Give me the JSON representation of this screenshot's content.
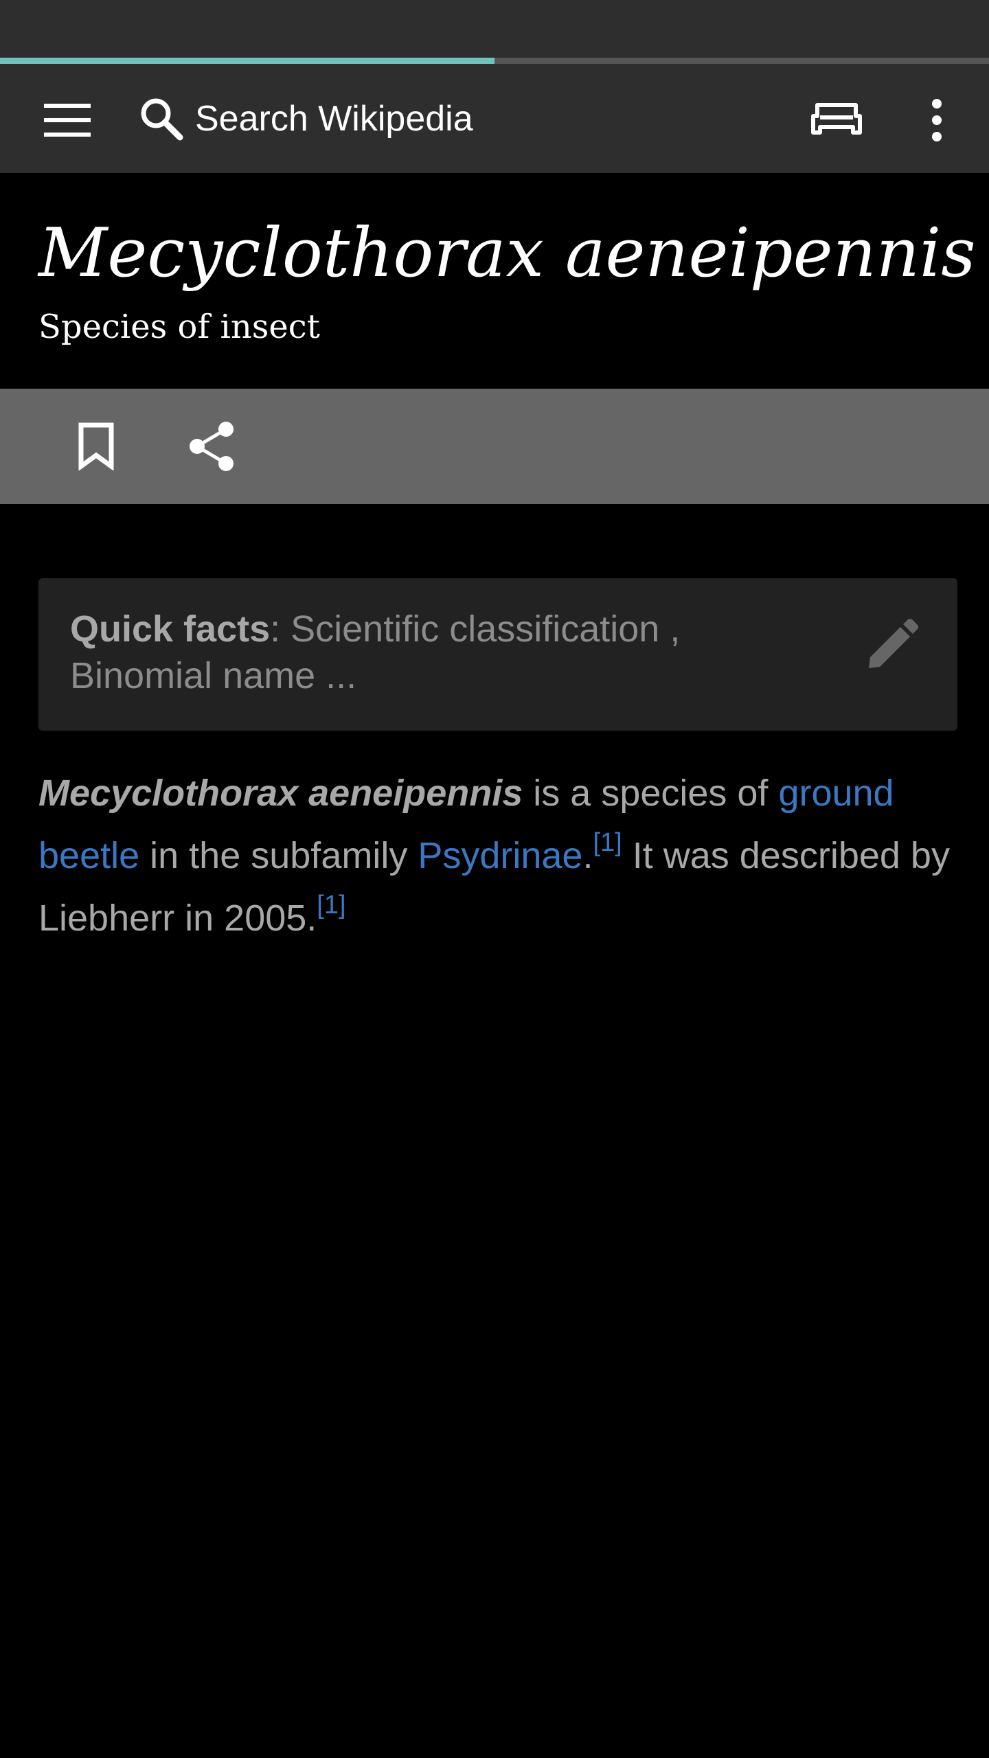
{
  "progress": {
    "fraction": 0.5
  },
  "toolbar": {
    "menu_icon": "hamburger-menu-icon",
    "search_icon": "search-icon",
    "search_placeholder": "Search Wikipedia",
    "tabs_icon": "tabs-icon",
    "overflow_icon": "more-vertical-icon"
  },
  "page": {
    "title": "Mecyclothorax aeneipennis",
    "description": "Species of insect"
  },
  "actions": {
    "bookmark_icon": "bookmark-icon",
    "share_icon": "share-icon"
  },
  "quick_facts": {
    "label": "Quick facts",
    "text": ": Scientific classification , Binomial name ...",
    "edit_icon": "edit-pencil-icon"
  },
  "article": {
    "lead": "Mecyclothorax aeneipennis",
    "t1": " is a species of ",
    "link1": "ground beetle",
    "t2": " in the subfamily ",
    "link2": "Psydrinae",
    "t3": ".",
    "ref1": "[1]",
    "t4": " It was described by Liebherr in 2005.",
    "ref2": "[1]"
  },
  "colors": {
    "toolbar_bg": "#2e2e2e",
    "progress_accent": "#6fc3bb",
    "action_bar_bg": "#666666",
    "quick_facts_bg": "#222222",
    "link": "#3b78c4",
    "body_text": "#a8a8a8"
  }
}
